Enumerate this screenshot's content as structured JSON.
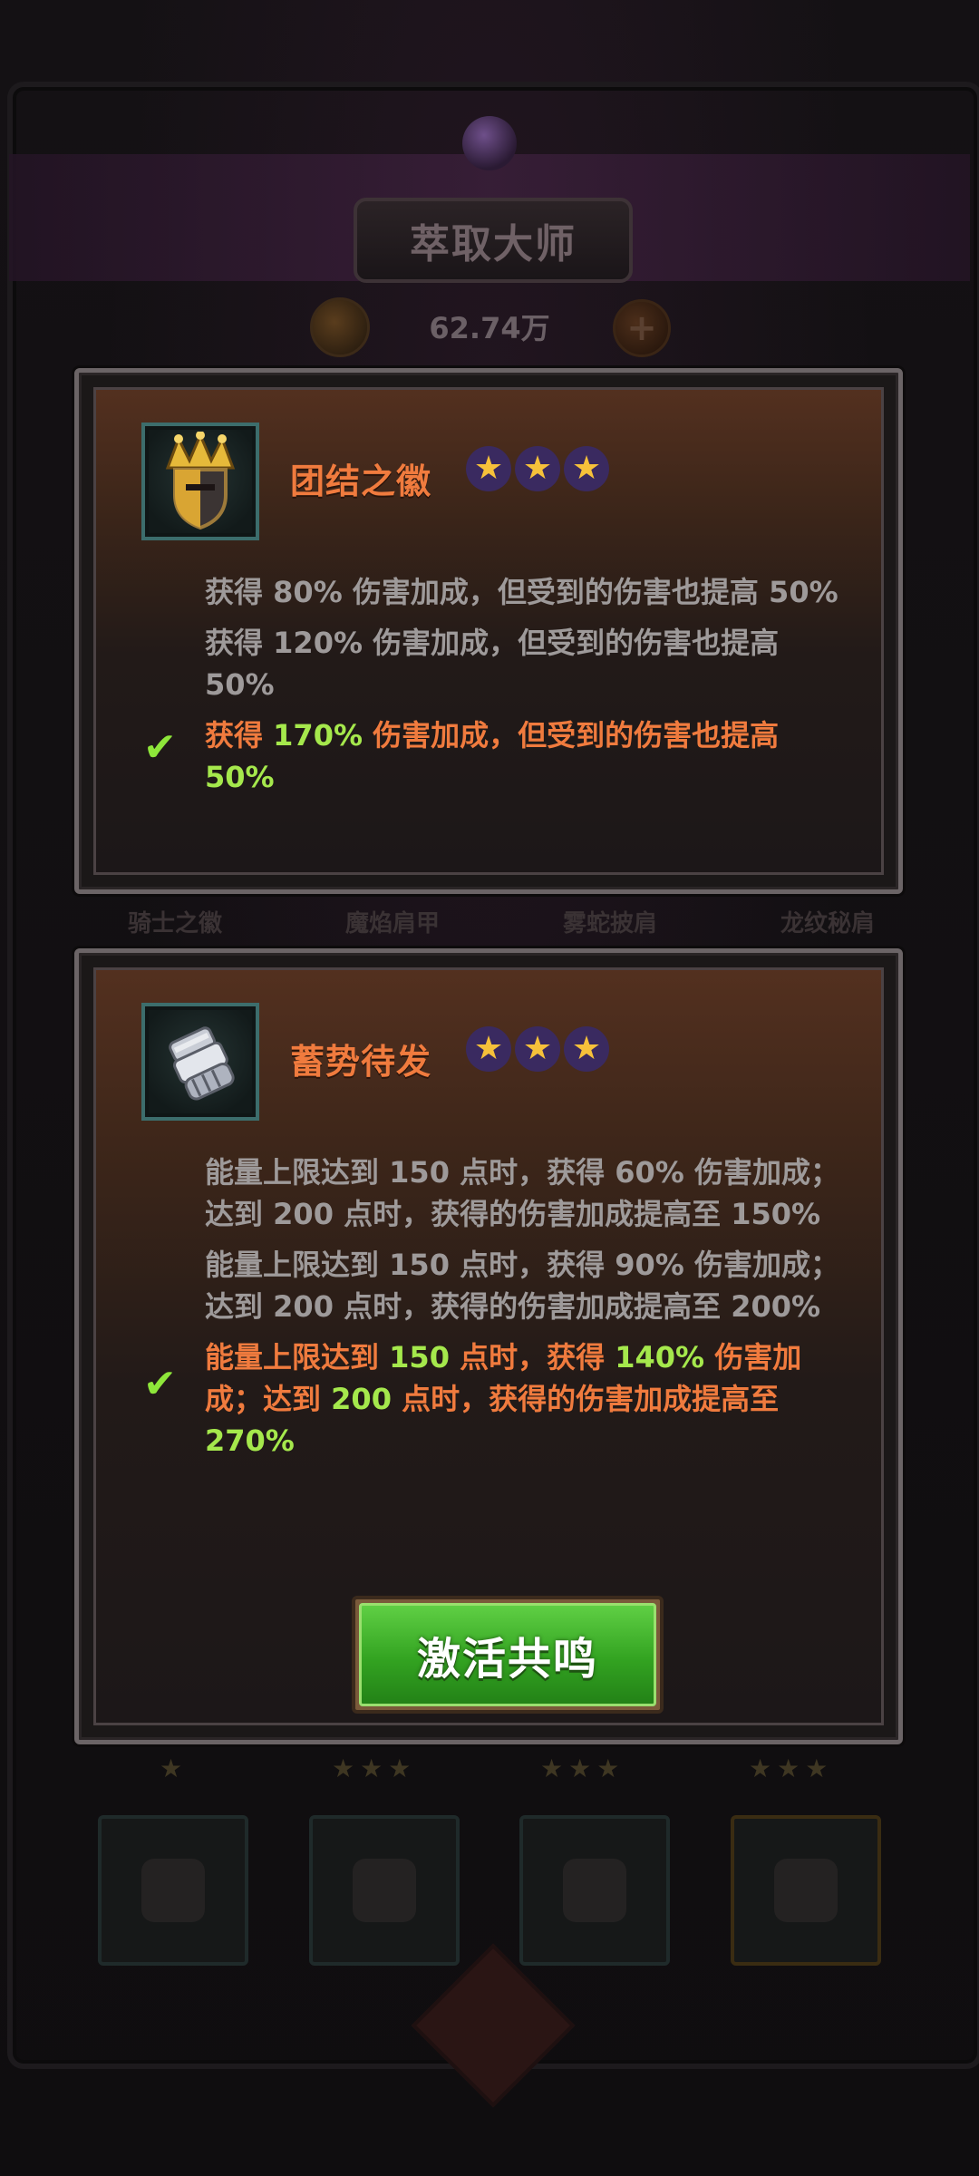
{
  "background": {
    "title": "萃取大师",
    "currency_amount": "62.74万",
    "plus_icon": "plus-icon",
    "equipment_labels": [
      "骑士之徽",
      "魔焰肩甲",
      "雾蛇披肩",
      "龙纹秘肩"
    ],
    "slot_star_counts": [
      1,
      3,
      3,
      3
    ]
  },
  "cards": [
    {
      "name": "团结之徽",
      "icon": "crown-shield-icon",
      "stars": 3,
      "levels": [
        {
          "pre": "获得 ",
          "num1": "80%",
          "mid": " 伤害加成，但受到的伤害也提高 ",
          "num2": "50%",
          "post": "",
          "active": false
        },
        {
          "pre": "获得 ",
          "num1": "120%",
          "mid": " 伤害加成，但受到的伤害也提高 ",
          "num2": "50%",
          "post": "",
          "active": false
        },
        {
          "pre": "获得 ",
          "num1": "170%",
          "mid": " 伤害加成，但受到的伤害也提高 ",
          "num2": "50%",
          "post": "",
          "active": true
        }
      ]
    },
    {
      "name": "蓄势待发",
      "icon": "gauntlet-icon",
      "stars": 3,
      "levels": [
        {
          "pre": "能量上限达到 ",
          "num1": "150",
          "mid": " 点时，获得 ",
          "num2": "60%",
          "mid2": " 伤害加成；达到 ",
          "num3": "200",
          "mid3": " 点时，获得的伤害加成提高至 ",
          "num4": "150%",
          "active": false
        },
        {
          "pre": "能量上限达到 ",
          "num1": "150",
          "mid": " 点时，获得 ",
          "num2": "90%",
          "mid2": " 伤害加成；达到 ",
          "num3": "200",
          "mid3": " 点时，获得的伤害加成提高至 ",
          "num4": "200%",
          "active": false
        },
        {
          "pre": "能量上限达到 ",
          "num1": "150",
          "mid": " 点时，获得 ",
          "num2": "140%",
          "mid2": " 伤害加成；达到 ",
          "num3": "200",
          "mid3": " 点时，获得的伤害加成提高至 ",
          "num4": "270%",
          "active": true
        }
      ],
      "button_label": "激活共鸣"
    }
  ],
  "colors": {
    "name_orange": "#f07b3e",
    "value_green": "#a5e84c",
    "inactive_text": "#9e9a9a",
    "button_green": "#33a321",
    "star_gold": "#f6c13a"
  }
}
